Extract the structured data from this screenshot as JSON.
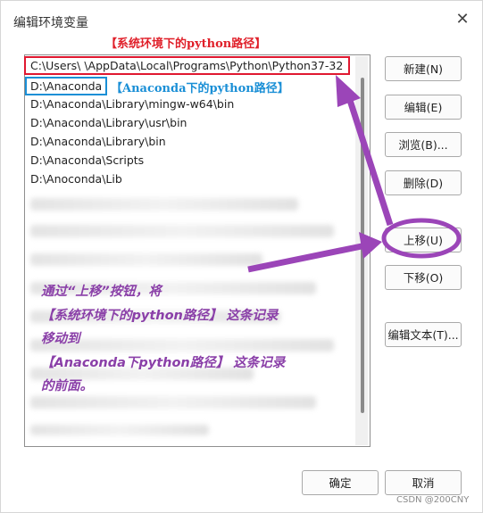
{
  "window": {
    "title": "编辑环境变量",
    "close_glyph": "✕"
  },
  "list": {
    "items": [
      "C:\\Users\\        \\AppData\\Local\\Programs\\Python\\Python37-32",
      "D:\\Anaconda",
      "D:\\Anaconda\\Library\\mingw-w64\\bin",
      "D:\\Anaconda\\Library\\usr\\bin",
      "D:\\Anaconda\\Library\\bin",
      "D:\\Anaconda\\Scripts",
      "D:\\Anoconda\\Lib"
    ]
  },
  "buttons": {
    "new": "新建(N)",
    "edit": "编辑(E)",
    "browse": "浏览(B)...",
    "delete": "删除(D)",
    "move_up": "上移(U)",
    "move_down": "下移(O)",
    "edit_text": "编辑文本(T)...",
    "ok": "确定",
    "cancel": "取消"
  },
  "annotations": {
    "top_label": "【系统环境下的python路径】",
    "blue_label": "【Anaconda下的python路径】",
    "instructions": [
      "通过“上移”按钮，将",
      "【系统环境下的python路径】 这条记录",
      "移动到",
      "【Anaconda下python路径】 这条记录",
      "的前面。"
    ],
    "red_color": "#e01830",
    "blue_color": "#1a8fd6",
    "purple_color": "#8a3fa8"
  },
  "watermark": "CSDN @200CNY"
}
